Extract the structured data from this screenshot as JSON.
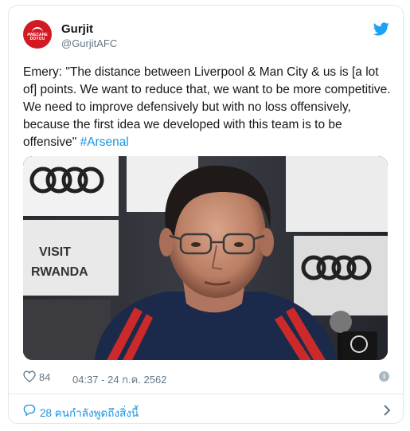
{
  "tweet": {
    "display_name": "Gurjit",
    "handle": "@GurjitAFC",
    "avatar_text_line1": "#WECARE",
    "avatar_text_line2": "DOYOU",
    "text": "Emery: \"The distance between Liverpool & Man City & us is [a lot of] points. We want to reduce that, we want to be more competitive. We need to improve defensively but with no loss offensively, because the first idea we developed with this team is to be offensive\" ",
    "hashtag": "#Arsenal",
    "likes": "84",
    "timestamp": "04:37 - 24 ก.ค. 2562",
    "info_glyph": "i"
  },
  "footer": {
    "talking_label": "28 คนกำลังพูดถึงสิ่งนี้"
  },
  "photo": {
    "backdrop_text_1": "VISIT",
    "backdrop_text_2": "RWANDA"
  },
  "colors": {
    "brand": "#1da1f2",
    "link": "#1b95e0",
    "muted": "#657786",
    "avatar_bg": "#d31a23",
    "shirt_navy": "#1b2a4a",
    "shirt_red": "#cc2a2a"
  }
}
